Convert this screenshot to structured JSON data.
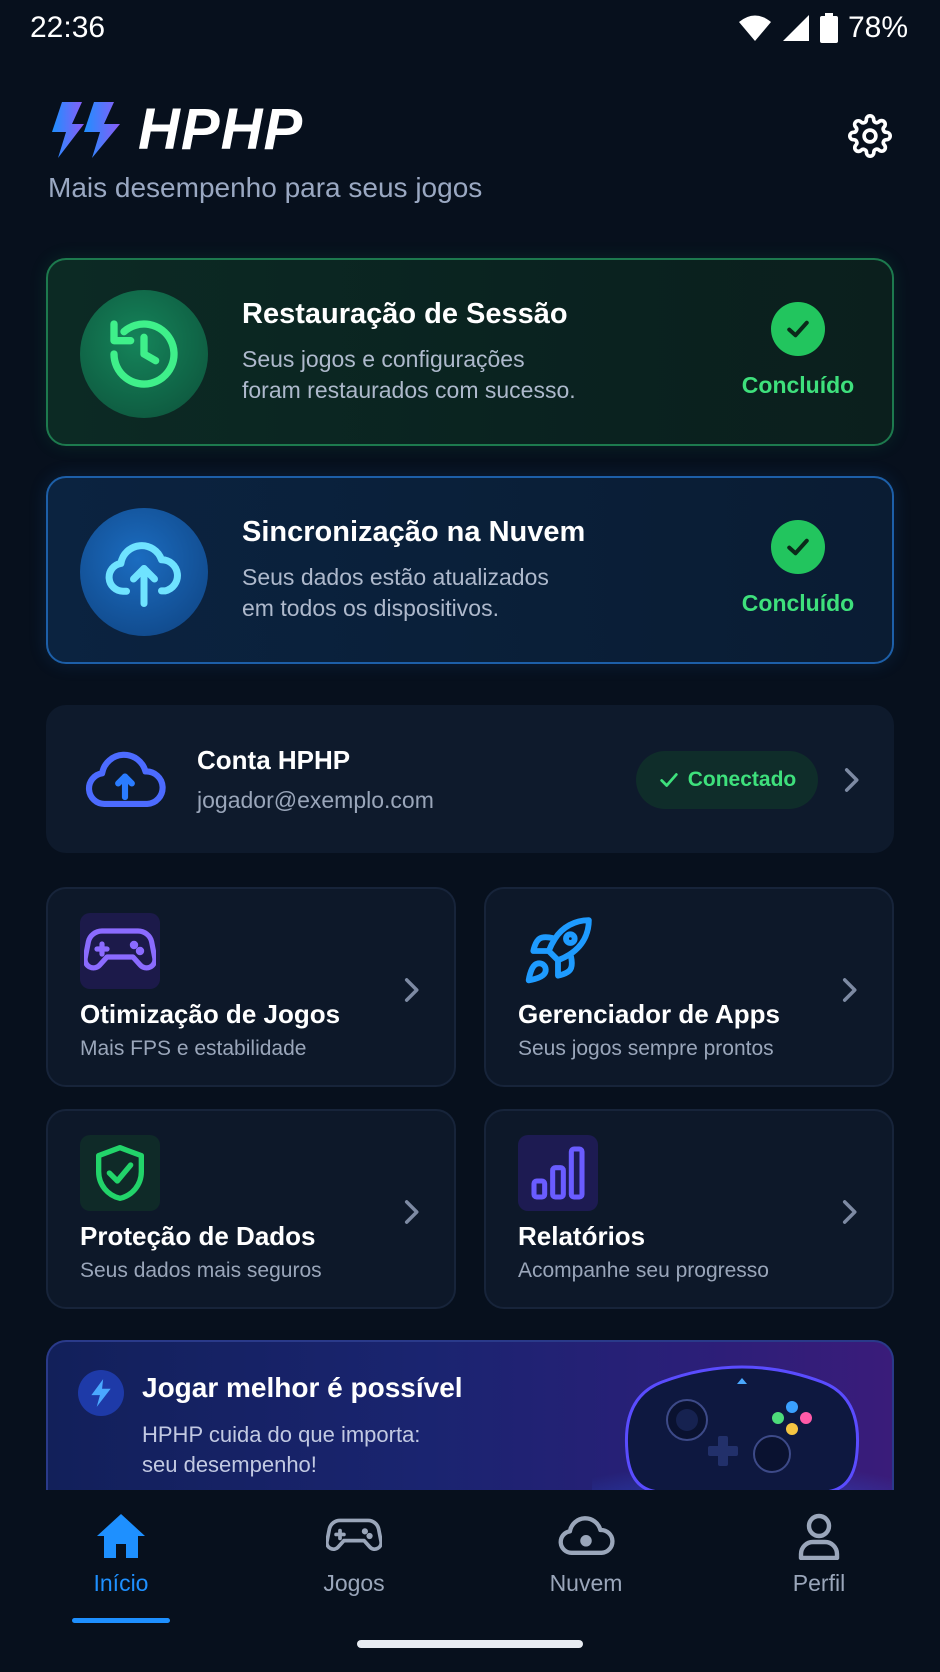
{
  "status_bar": {
    "time": "22:36",
    "battery": "78%"
  },
  "header": {
    "app_name": "HPHP",
    "tagline": "Mais desempenho para seus jogos",
    "settings_icon": "gear-icon"
  },
  "colors": {
    "background": "#07101d",
    "success": "#22c55e",
    "success_text": "#3ee07c",
    "accent_blue": "#1e90ff",
    "accent_purple": "#7c5cff"
  },
  "session_card": {
    "title": "Restauração de Sessão",
    "description": "Seus jogos e configurações\nforam restaurados com sucesso.",
    "status": "Concluído",
    "icon": "history-icon"
  },
  "sync_card": {
    "title": "Sincronização na Nuvem",
    "description": "Seus dados estão atualizados\nem todos os dispositivos.",
    "status": "Concluído",
    "icon": "cloud-upload-icon"
  },
  "account": {
    "title": "Conta HPHP",
    "email": "jogador@exemplo.com",
    "badge": "Conectado"
  },
  "tiles": [
    {
      "title": "Otimização de Jogos",
      "subtitle": "Mais FPS e estabilidade",
      "icon": "gamepad-icon"
    },
    {
      "title": "Gerenciador de Apps",
      "subtitle": "Seus jogos sempre prontos",
      "icon": "rocket-icon"
    },
    {
      "title": "Proteção de Dados",
      "subtitle": "Seus dados mais seguros",
      "icon": "shield-check-icon"
    },
    {
      "title": "Relatórios",
      "subtitle": "Acompanhe seu progresso",
      "icon": "bar-chart-icon"
    }
  ],
  "promo": {
    "title": "Jogar melhor é possível",
    "text": "HPHP cuida do que importa:\nseu desempenho!",
    "icon": "lightning-icon"
  },
  "bottom_nav": [
    {
      "label": "Início",
      "icon": "home-icon",
      "active": true
    },
    {
      "label": "Jogos",
      "icon": "gamepad-icon",
      "active": false
    },
    {
      "label": "Nuvem",
      "icon": "cloud-icon",
      "active": false
    },
    {
      "label": "Perfil",
      "icon": "user-icon",
      "active": false
    }
  ]
}
